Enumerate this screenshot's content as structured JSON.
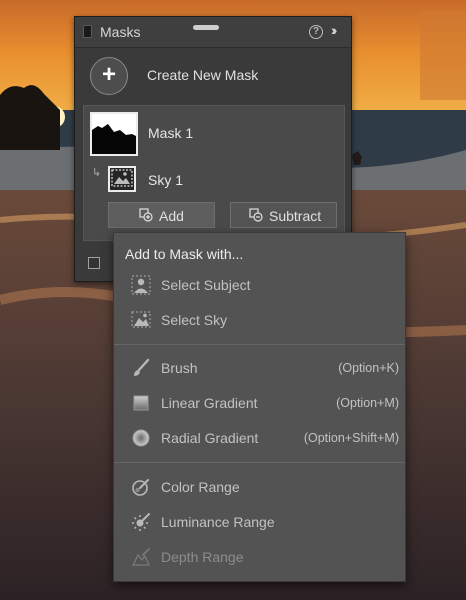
{
  "panel": {
    "title": "Masks",
    "create_label": "Create New Mask",
    "create_symbol": "+",
    "mask_name": "Mask 1",
    "component_name": "Sky 1",
    "add_label": "Add",
    "subtract_label": "Subtract"
  },
  "menu": {
    "heading": "Add to Mask with...",
    "items": [
      {
        "label": "Select Subject",
        "shortcut": "",
        "icon": "select-subject-icon"
      },
      {
        "label": "Select Sky",
        "shortcut": "",
        "icon": "select-sky-icon"
      },
      {
        "label": "Brush",
        "shortcut": "(Option+K)",
        "icon": "brush-icon"
      },
      {
        "label": "Linear Gradient",
        "shortcut": "(Option+M)",
        "icon": "linear-gradient-icon"
      },
      {
        "label": "Radial Gradient",
        "shortcut": "(Option+Shift+M)",
        "icon": "radial-gradient-icon"
      },
      {
        "label": "Color Range",
        "shortcut": "",
        "icon": "color-range-icon"
      },
      {
        "label": "Luminance Range",
        "shortcut": "",
        "icon": "luminance-range-icon"
      },
      {
        "label": "Depth Range",
        "shortcut": "",
        "icon": "depth-range-icon",
        "disabled": true
      }
    ]
  },
  "colors": {
    "panel_bg": "#3a3a3a",
    "menu_bg": "#535353",
    "text": "#c2c2c2",
    "disabled_text": "#8c8c8c"
  }
}
